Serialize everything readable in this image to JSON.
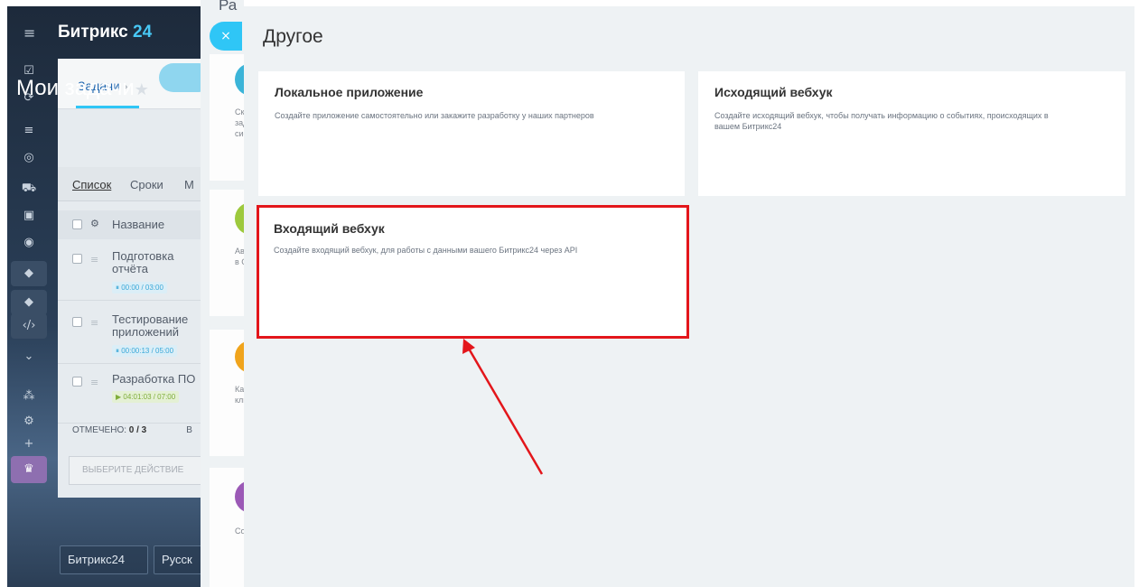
{
  "left_app": {
    "brand_name": "Битрикс",
    "brand_suffix": "24",
    "tab_tasks": "Задачи",
    "tab_chevron": "›",
    "page_title": "Мои задачи",
    "page_title_star": "★",
    "view_tabs": [
      "Список",
      "Сроки",
      "М"
    ],
    "grid_header": "Название",
    "tasks": [
      {
        "title": "Подготовка отчёта",
        "time": "00:00 / 03:00",
        "running": false
      },
      {
        "title": "Тестирование приложений",
        "time": "00:00:13 / 05:00",
        "running": false
      },
      {
        "title": "Разработка ПО",
        "time": "04:01:03 / 07:00",
        "running": true
      }
    ],
    "marked_label": "ОТМЕЧЕНО:",
    "marked_value": "0 / 3",
    "marked_extra": "В",
    "action_placeholder": "ВЫБЕРИТЕ ДЕЙСТВИЕ",
    "footer_brand": "Битрикс24",
    "footer_lang": "Русск"
  },
  "mid_panel": {
    "header": "Ра",
    "snippets": [
      "Ско зад сис",
      "Авт в СР",
      "Кас кли",
      "Соз"
    ]
  },
  "slider": {
    "close_glyph": "×",
    "title": "Другое",
    "cards": [
      {
        "title": "Локальное приложение",
        "description": "Создайте приложение самостоятельно или закажите разработку у наших партнеров"
      },
      {
        "title": "Исходящий вебхук",
        "description": "Создайте исходящий вебхук, чтобы получать информацию о событиях, происходящих в вашем Битрикс24"
      },
      {
        "title": "Входящий вебхук",
        "description": "Создайте входящий вебхук, для работы с данными вашего Битрикс24 через API"
      }
    ]
  },
  "colors": {
    "highlight": "#e3161b",
    "accent": "#2fc6f6",
    "arrow": "#e3161b"
  }
}
